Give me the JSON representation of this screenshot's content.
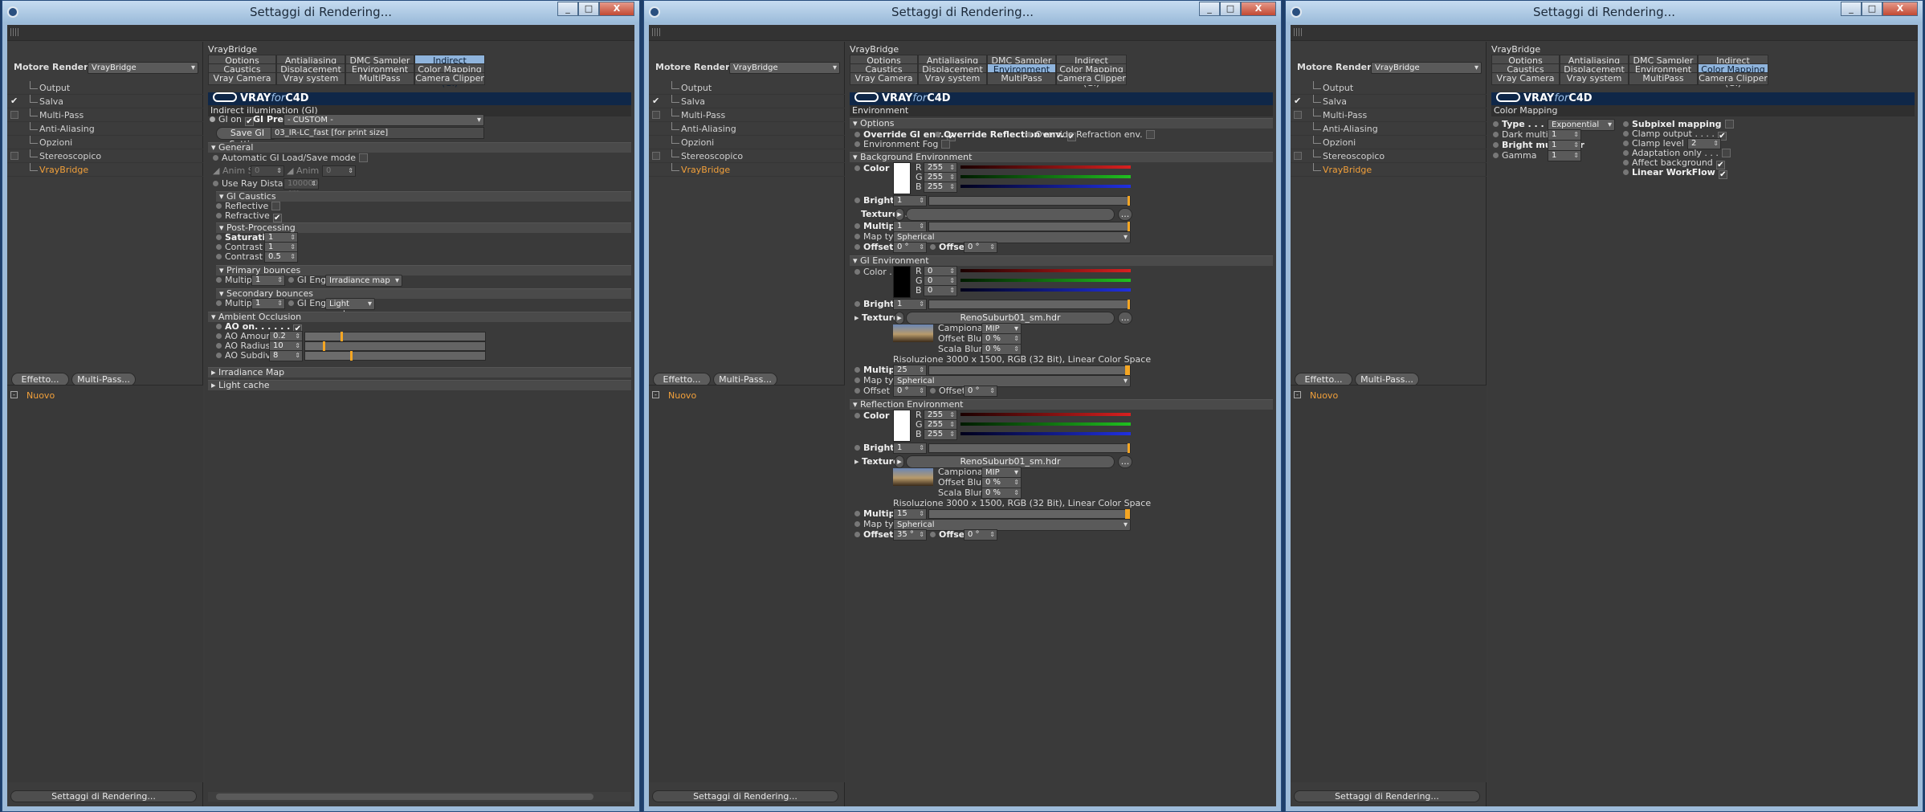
{
  "window_title": "Settaggi di Rendering...",
  "window_buttons": {
    "minimize": "_",
    "maximize": "□",
    "close": "X"
  },
  "left_panel": {
    "motore_label": "Motore Render",
    "engine": "VrayBridge",
    "items": [
      "Output",
      "Salva",
      "Multi-Pass",
      "Anti-Aliasing",
      "Opzioni",
      "Stereoscopico",
      "VrayBridge"
    ],
    "effetto_button": "Effetto...",
    "multipass_button": "Multi-Pass...",
    "nuovo": "Nuovo",
    "bottom_button": "Settaggi di Rendering..."
  },
  "vraybridge_title": "VrayBridge",
  "tabs": [
    "Options",
    "Antialiasing",
    "DMC Sampler",
    "Indirect illumination (GI)",
    "Caustics",
    "Displacement",
    "Environment",
    "Color Mapping",
    "Vray Camera",
    "Vray system",
    "MultiPass",
    "Camera Clipper"
  ],
  "logo": {
    "vray": "VRAY",
    "for": "for",
    "c4d": "C4D"
  },
  "gi": {
    "header": "Indirect illumination (GI)",
    "gi_on": "GI on",
    "presets_label": "GI Presets",
    "presets_value": "- CUSTOM -",
    "save_button": "Save GI Settings",
    "file": "03_IR-LC_fast [for print size]",
    "general": "General",
    "auto_load": "Automatic GI Load/Save mode",
    "anim_start": "Anim Start",
    "anim_start_val": "0",
    "anim_end": "Anim End",
    "anim_end_val": "0",
    "ray_distance": "Use Ray Distance",
    "ray_distance_val": "100000 cm",
    "caustics": "GI Caustics",
    "reflective": "Reflective",
    "refractive": "Refractive",
    "post": "Post-Processing",
    "saturation": "Saturation . . .",
    "saturation_val": "1",
    "contrast": "Contrast . . . .",
    "contrast_val": "1",
    "contrast_base": "Contrast base",
    "contrast_base_val": "0.5",
    "primary": "Primary bounces",
    "multiplier": "Multiplier",
    "primary_mult": "1",
    "gi_engine": "GI Engine",
    "primary_engine": "Irradiance map",
    "secondary": "Secondary bounces",
    "secondary_mult": "1",
    "secondary_engine": "Light cache",
    "ao": "Ambient Occlusion",
    "ao_on": "AO on. . . . . .",
    "ao_amount": "AO Amount . . .",
    "ao_amount_val": "0.2",
    "ao_radius": "AO Radius . . .",
    "ao_radius_val": "10",
    "ao_subdiv": "AO Subdivision",
    "ao_subdiv_val": "8",
    "irradiance": "Irradiance Map",
    "lightcache": "Light cache"
  },
  "env": {
    "header": "Environment",
    "options": "Options",
    "override_gi": "Override GI env.",
    "override_refl": "Override Reflection env.",
    "override_refr": "Override Refraction env.",
    "env_fog": "Environment Fog",
    "bg": "Background Environment",
    "color": "Color . . .",
    "r": "R",
    "g": "G",
    "b": "B",
    "brightness": "Brightness",
    "texture": "Texture. . .",
    "multiplier": "Multiplier",
    "map_type": "Map type",
    "map_type_val": "Spherical",
    "offset_u": "Offset U",
    "offset_v": "Offset V",
    "bg_rgb": [
      "255",
      "255",
      "255"
    ],
    "bg_brightness": "1",
    "bg_multiplier": "1",
    "bg_offset_u": "0 °",
    "bg_offset_v": "0 °",
    "gi_env": "GI Environment",
    "gi_rgb": [
      "0",
      "0",
      "0"
    ],
    "gi_brightness": "1",
    "hdr_file": "RenoSuburb01_sm.hdr",
    "campionamento": "Campionamento",
    "camp_val": "MIP",
    "offset_blur": "Offset Blur",
    "offset_blur_val": "0 %",
    "scala_blur": "Scala Blur",
    "scala_blur_val": "0 %",
    "risoluzione": "Risoluzione 3000 x 1500, RGB (32 Bit), Linear Color Space",
    "gi_multiplier": "25",
    "gi_offset_u": "0 °",
    "gi_offset_v": "0 °",
    "refl": "Reflection Environment",
    "refl_rgb": [
      "255",
      "255",
      "255"
    ],
    "refl_brightness": "1",
    "refl_multiplier": "15",
    "refl_offset_u": "35 °",
    "refl_offset_v": "0 °",
    "more": "..."
  },
  "cm": {
    "header": "Color Mapping",
    "type": "Type . . . . . . . . .",
    "type_val": "Exponential",
    "dark": "Dark multiplier",
    "dark_val": "1",
    "bright": "Bright multiplier",
    "bright_val": "1",
    "gamma": "Gamma",
    "gamma_val": "1",
    "subpixel": "Subpixel mapping",
    "clamp_out": "Clamp output . . . .",
    "clamp_level": "Clamp level . . . . .",
    "clamp_level_val": "2",
    "adaptation": "Adaptation only . . .",
    "affect_bg": "Affect background",
    "linear": "Linear WorkFlow"
  }
}
